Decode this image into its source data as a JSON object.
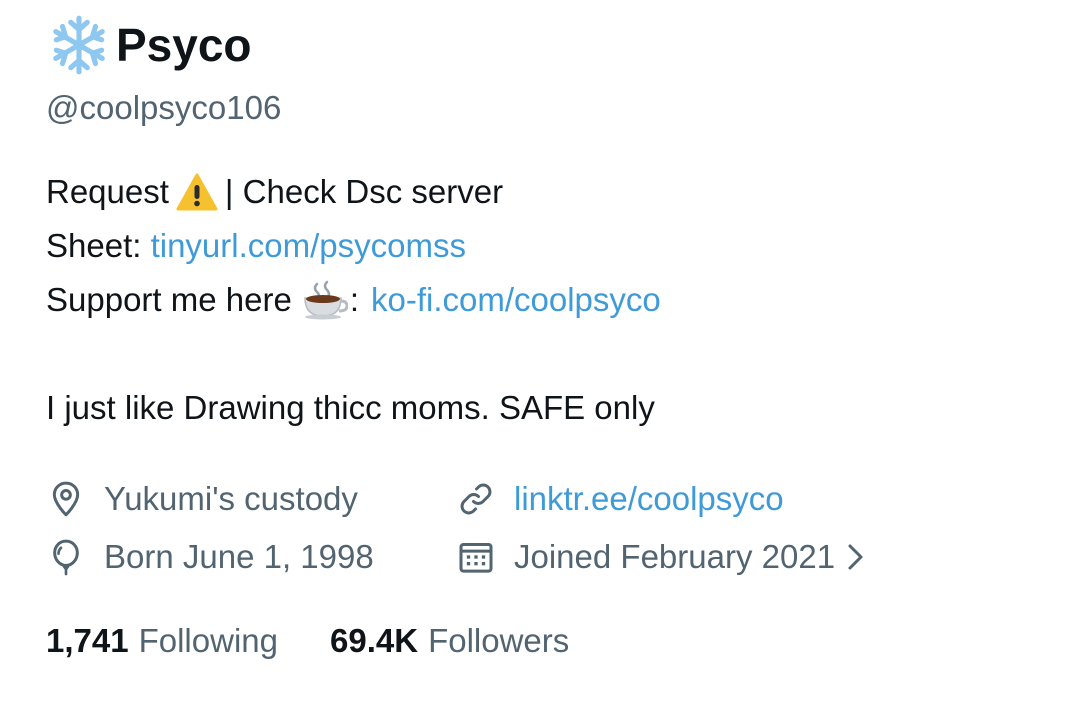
{
  "profile": {
    "display_name": "Psyco",
    "name_emoji": "snowflake-icon",
    "handle": "@coolpsyco106"
  },
  "bio": {
    "line1_text": "Request",
    "line1_emoji": "warning-icon",
    "line1_suffix": "| Check Dsc server",
    "line2_label": "Sheet: ",
    "line2_link": "tinyurl.com/psycomss",
    "line3_label": "Support me here",
    "line3_emoji": "coffee-icon",
    "line3_colon": ":",
    "line3_link": "ko-fi.com/coolpsyco",
    "line4_text": "I just like Drawing thicc moms. SAFE only"
  },
  "meta": {
    "location": "Yukumi's custody",
    "website": "linktr.ee/coolpsyco",
    "birthday": "Born June 1, 1998",
    "joined": "Joined February 2021"
  },
  "stats": {
    "following_count": "1,741",
    "following_label": "Following",
    "followers_count": "69.4K",
    "followers_label": "Followers"
  },
  "colors": {
    "text": "#0f1419",
    "secondary": "#536471",
    "link": "#3f9ad8",
    "snowflake": "#8ec8f0",
    "warning": "#f5c12e"
  }
}
